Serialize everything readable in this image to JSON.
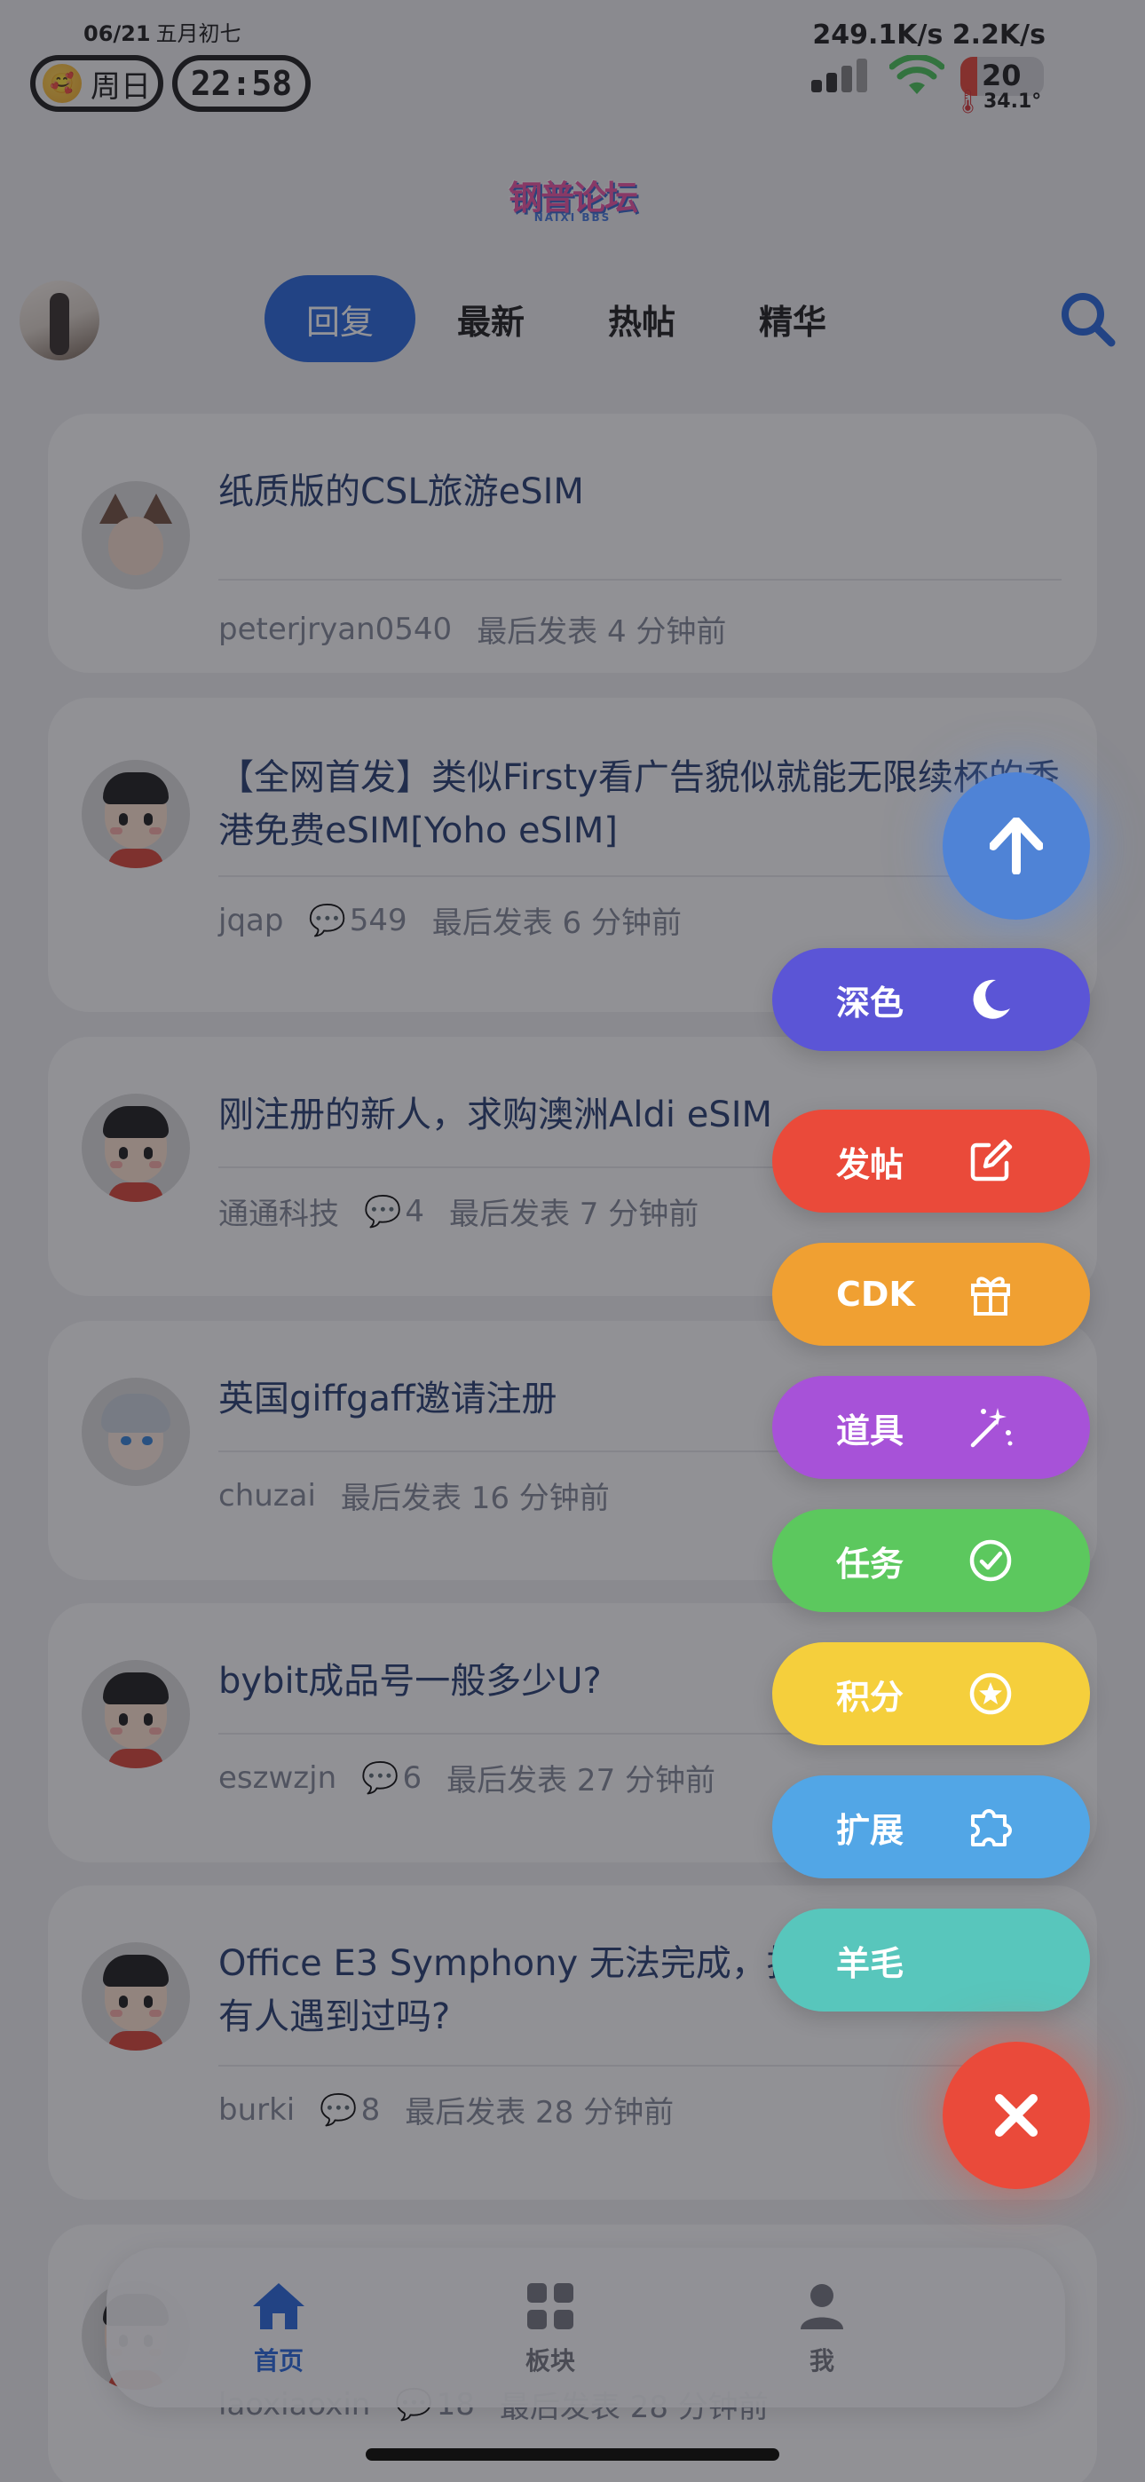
{
  "status_bar": {
    "date": "06/21",
    "lunar_date": "五月初七",
    "weekday": "周日",
    "weekday_emoji": "🥰",
    "time": "22:58",
    "network_speed": "249.1K/s 2.2K/s",
    "battery_level": "20",
    "battery_fraction": 0.2,
    "temperature": "34.1°"
  },
  "header": {
    "logo_text": "钢普论坛",
    "logo_subtext": "NAIXI BBS"
  },
  "tabs": [
    {
      "label": "回复",
      "active": true
    },
    {
      "label": "最新",
      "active": false
    },
    {
      "label": "热帖",
      "active": false
    },
    {
      "label": "精华",
      "active": false
    }
  ],
  "posts": [
    {
      "title": "纸质版的CSL旅游eSIM",
      "author": "peterjryan0540",
      "comments": "",
      "last_post": "最后发表 4 分钟前"
    },
    {
      "title": "【全网首发】类似Firsty看广告貌似就能无限续杯的香港免费eSIM[Yoho eSIM]",
      "author": "jqap",
      "comments": "549",
      "last_post": "最后发表 6 分钟前"
    },
    {
      "title": "刚注册的新人，求购澳洲Aldi eSIM",
      "author": "通通科技",
      "comments": "4",
      "last_post": "最后发表 7 分钟前"
    },
    {
      "title": "英国giffgaff邀请注册",
      "author": "chuzai",
      "comments": "",
      "last_post": "最后发表 16 分钟前"
    },
    {
      "title": "bybit成品号一般多少U?",
      "author": "eszwzjn",
      "comments": "6",
      "last_post": "最后发表 27 分钟前"
    },
    {
      "title": "Office E3 Symphony 无法完成，按钮始终为灰色，有人遇到过吗?",
      "author": "burki",
      "comments": "8",
      "last_post": "最后发表 28 分钟前"
    },
    {
      "title": "",
      "author": "laoxiaoxin",
      "comments": "18",
      "last_post": "最后发表 28 分钟前"
    }
  ],
  "fab_menu": [
    {
      "label": "深色",
      "icon": "moon-icon",
      "color": "#5b55d6"
    },
    {
      "label": "发帖",
      "icon": "edit-icon",
      "color": "#ea4a3a"
    },
    {
      "label": "CDK",
      "icon": "gift-icon",
      "color": "#f0a032"
    },
    {
      "label": "道具",
      "icon": "magic-wand-icon",
      "color": "#a752d8"
    },
    {
      "label": "任务",
      "icon": "check-circle-icon",
      "color": "#5cc85e"
    },
    {
      "label": "积分",
      "icon": "star-circle-icon",
      "color": "#f5cf3c"
    },
    {
      "label": "扩展",
      "icon": "puzzle-icon",
      "color": "#52a6e6"
    },
    {
      "label": "羊毛",
      "icon": "",
      "color": "#58c6bc"
    }
  ],
  "bottom_nav": [
    {
      "label": "首页",
      "icon": "home-icon",
      "active": true
    },
    {
      "label": "板块",
      "icon": "grid-icon",
      "active": false
    },
    {
      "label": "我",
      "icon": "user-icon",
      "active": false
    }
  ],
  "colors": {
    "accent": "#1c5fd8",
    "scroll_top_fab": "#4f83d6",
    "close_fab": "#ea4a3a"
  }
}
